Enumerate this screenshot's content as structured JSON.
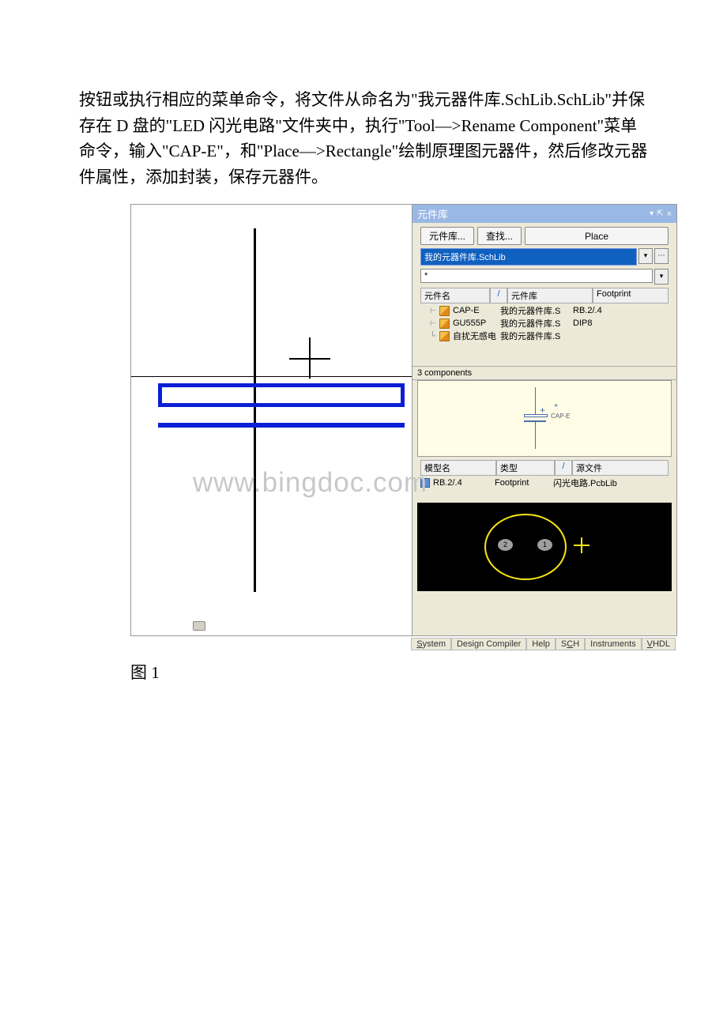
{
  "body_text": "按钮或执行相应的菜单命令，将文件从命名为\"我元器件库.SchLib.SchLib\"并保存在 D 盘的\"LED 闪光电路\"文件夹中，执行\"Tool—>Rename Component\"菜单命令，输入\"CAP-E\"，和\"Place—>Rectangle\"绘制原理图元器件，然后修改元器件属性，添加封装，保存元器件。",
  "caption": "图 1",
  "watermark": "www.bingdoc.com",
  "panel": {
    "title": "元件库",
    "btn_lib": "元件库...",
    "btn_search": "查找...",
    "btn_place": "Place",
    "selected_lib": "我的元器件库.SchLib",
    "filter": "*",
    "list_head": {
      "c1": "元件名",
      "c2": "/",
      "c3": "元件库",
      "c4": "Footprint"
    },
    "components": [
      {
        "name": "CAP-E",
        "lib": "我的元器件库.S",
        "fp": "RB.2/.4"
      },
      {
        "name": "GU555P",
        "lib": "我的元器件库.S",
        "fp": "DIP8"
      },
      {
        "name": "自扰无感电",
        "lib": "我的元器件库.S",
        "fp": ""
      }
    ],
    "count": "3 components",
    "preview_label": "CAP-E",
    "model_head": {
      "c1": "模型名",
      "c2": "类型",
      "c3": "/",
      "c4": "源文件"
    },
    "models": [
      {
        "name": "RB.2/.4",
        "type": "Footprint",
        "src": "闪光电路.PcbLib"
      }
    ],
    "pads": [
      "2",
      "1"
    ]
  },
  "status": {
    "t1": "System",
    "t2": "Design Compiler",
    "t3": "Help",
    "t4": "SCH",
    "t5": "Instruments",
    "t6": "VHDL"
  }
}
